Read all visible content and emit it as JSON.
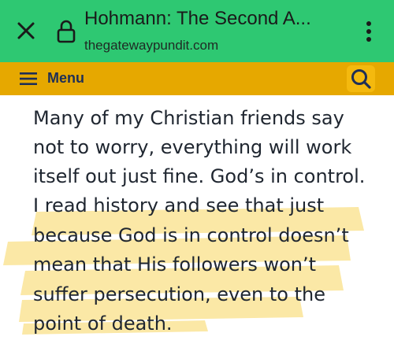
{
  "browser": {
    "title": "Hohmann: The Second A...",
    "domain": "thegatewaypundit.com"
  },
  "site_nav": {
    "menu_label": "Menu"
  },
  "article": {
    "lines": [
      "Many of my Christian friends say",
      "not to worry, everything will work",
      "itself out just fine. God’s in control.",
      "I read history and see that just",
      "because God is in control doesn’t",
      "mean that His followers won’t",
      "suffer persecution, even to the",
      "point of death."
    ]
  },
  "colors": {
    "browser_bar": "#2ec872",
    "menu_bar": "#e6a800",
    "search_button": "#f4b90e",
    "highlighter": "#fbe8a6"
  },
  "icons": {
    "close": "close-icon",
    "lock": "lock-icon",
    "more": "more-vert-icon",
    "menu": "hamburger-icon",
    "search": "search-icon"
  }
}
